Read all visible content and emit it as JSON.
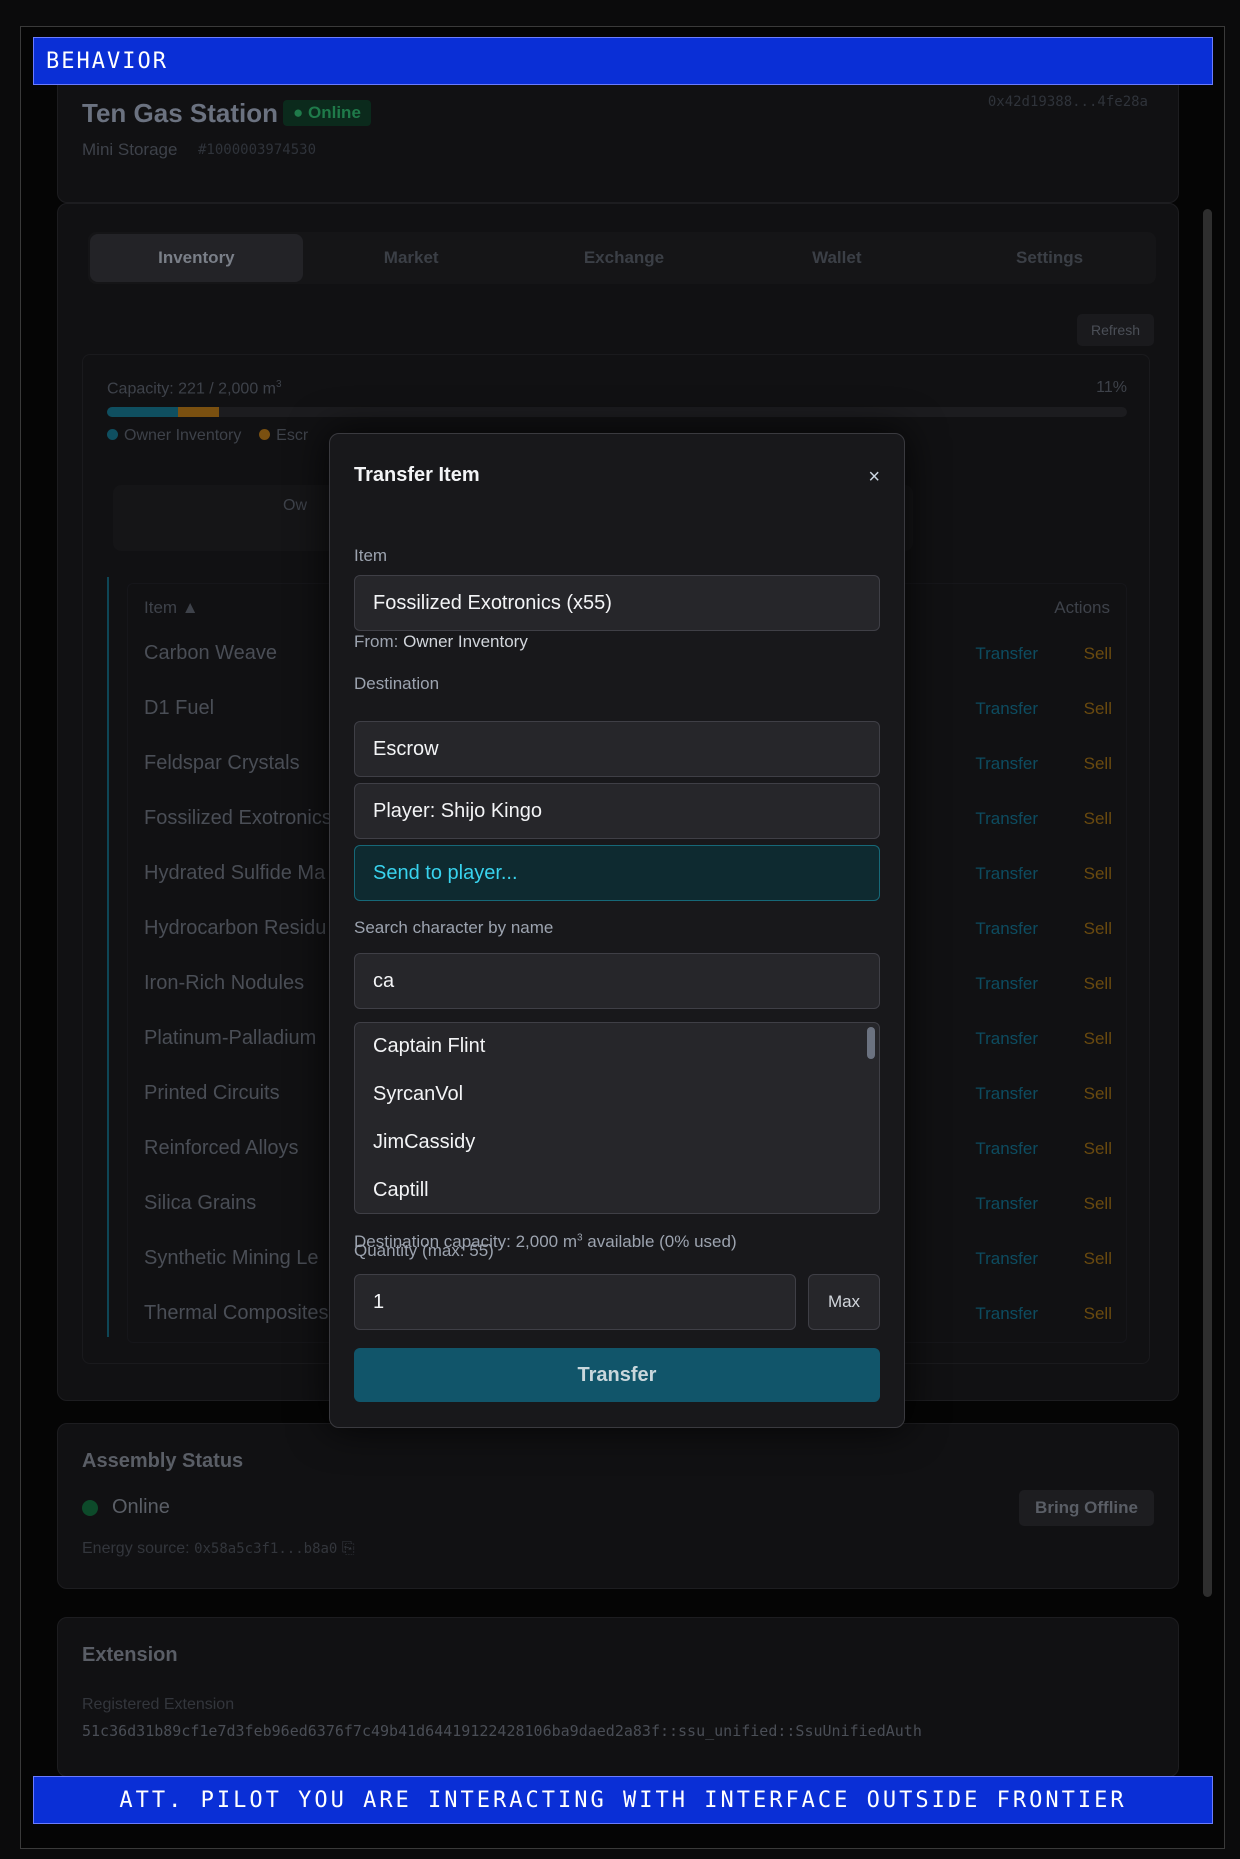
{
  "banner_top": "BEHAVIOR",
  "banner_bottom": "ATT. PILOT YOU ARE INTERACTING WITH INTERFACE OUTSIDE FRONTIER",
  "header": {
    "title": "Ten Gas Station",
    "status": "Online",
    "subtitle": "Mini Storage",
    "id": "#1000003974530",
    "address": "0x42d19388...4fe28a"
  },
  "tabs": [
    "Inventory",
    "Market",
    "Exchange",
    "Wallet",
    "Settings"
  ],
  "refresh_label": "Refresh",
  "capacity": {
    "label": "Capacity: 221 / 2,000 m",
    "percent_text": "11%",
    "owner_fraction": 0.07,
    "escrow_fraction": 0.04,
    "legend_owner": "Owner Inventory",
    "legend_escrow": "Escr",
    "owner_pill": "Ow"
  },
  "table": {
    "col_item": "Item ▲",
    "col_actions": "Actions",
    "transfer_label": "Transfer",
    "sell_label": "Sell",
    "rows": [
      "Carbon Weave",
      "D1 Fuel",
      "Feldspar Crystals",
      "Fossilized Exotronics",
      "Hydrated Sulfide Ma",
      "Hydrocarbon Residu",
      "Iron-Rich Nodules",
      "Platinum-Palladium",
      "Printed Circuits",
      "Reinforced Alloys",
      "Silica Grains",
      "Synthetic Mining Le",
      "Thermal Composites"
    ]
  },
  "assembly": {
    "title": "Assembly Status",
    "status": "Online",
    "bring_offline": "Bring Offline",
    "energy_label": "Energy source:",
    "energy_value": "0x58a5c3f1...b8a0"
  },
  "extension": {
    "title": "Extension",
    "registered_label": "Registered Extension",
    "registered_value": "51c36d31b89cf1e7d3feb96ed6376f7c49b41d64419122428106ba9daed2a83f::ssu_unified::SsuUnifiedAuth"
  },
  "modal": {
    "title": "Transfer Item",
    "close": "×",
    "item_label": "Item",
    "item_value": "Fossilized Exotronics (x55)",
    "from_label": "From:",
    "from_value": "Owner Inventory",
    "destination_label": "Destination",
    "destinations": [
      "Escrow",
      "Player: Shijo Kingo",
      "Send to player..."
    ],
    "search_label": "Search character by name",
    "search_value": "ca",
    "results": [
      "Captain Flint",
      "SyrcanVol",
      "JimCassidy",
      "Captill"
    ],
    "dest_capacity": "Destination capacity: 2,000 m",
    "dest_capacity_tail": " available (0% used)",
    "superscript": "3",
    "quantity_label": "Quantity (max: 55)",
    "quantity_value": "1",
    "max_label": "Max",
    "transfer_label": "Transfer"
  }
}
